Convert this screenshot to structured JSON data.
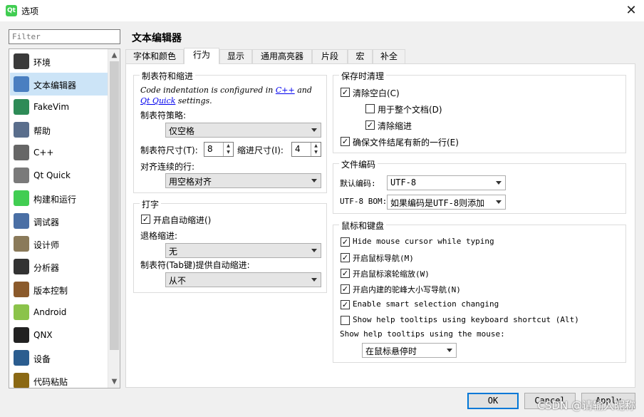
{
  "window": {
    "title": "选项",
    "app_icon": "Qt",
    "close": "✕"
  },
  "filter": {
    "placeholder": "Filter"
  },
  "sidebar": {
    "items": [
      {
        "label": "环境",
        "icon": "monitor-icon",
        "color": "#3a3a3a"
      },
      {
        "label": "文本编辑器",
        "icon": "text-editor-icon",
        "color": "#4a7fc1"
      },
      {
        "label": "FakeVim",
        "icon": "fakevim-icon",
        "color": "#2e8b57"
      },
      {
        "label": "帮助",
        "icon": "help-icon",
        "color": "#5a6e8c"
      },
      {
        "label": "C++",
        "icon": "braces-icon",
        "color": "#666666"
      },
      {
        "label": "Qt Quick",
        "icon": "qtquick-icon",
        "color": "#7a7a7a"
      },
      {
        "label": "构建和运行",
        "icon": "build-run-icon",
        "color": "#41cd52"
      },
      {
        "label": "调试器",
        "icon": "debugger-icon",
        "color": "#4a6fa5"
      },
      {
        "label": "设计师",
        "icon": "designer-icon",
        "color": "#8a7a5a"
      },
      {
        "label": "分析器",
        "icon": "analyzer-icon",
        "color": "#333333"
      },
      {
        "label": "版本控制",
        "icon": "version-control-icon",
        "color": "#8b5a2b"
      },
      {
        "label": "Android",
        "icon": "android-icon",
        "color": "#8bc34a"
      },
      {
        "label": "QNX",
        "icon": "qnx-icon",
        "color": "#222222"
      },
      {
        "label": "设备",
        "icon": "device-icon",
        "color": "#2b5d8f"
      },
      {
        "label": "代码粘贴",
        "icon": "paste-icon",
        "color": "#8b6914"
      }
    ]
  },
  "page_title": "文本编辑器",
  "tabs": [
    "字体和颜色",
    "行为",
    "显示",
    "通用高亮器",
    "片段",
    "宏",
    "补全"
  ],
  "tabs_and_indent": {
    "title": "制表符和缩进",
    "info_prefix": "Code indentation is configured in ",
    "info_link1": "C++",
    "info_mid": " and",
    "info_link2": "Qt Quick",
    "info_suffix": " settings.",
    "tab_policy_label": "制表符策略:",
    "tab_policy_value": "仅空格",
    "tab_size_label": "制表符尺寸(T):",
    "tab_size_value": "8",
    "indent_size_label": "缩进尺寸(I):",
    "indent_size_value": "4",
    "align_label": "对齐连续的行:",
    "align_value": "用空格对齐"
  },
  "typing": {
    "title": "打字",
    "auto_indent_label": "开启自动缩进()",
    "auto_indent_checked": true,
    "backspace_label": "退格缩进:",
    "backspace_value": "无",
    "tab_key_label": "制表符(Tab键)提供自动缩进:",
    "tab_key_value": "从不"
  },
  "cleanup": {
    "title": "保存时清理",
    "clean_ws_label": "清除空白(C)",
    "clean_ws_checked": true,
    "whole_doc_label": "用于整个文档(D)",
    "whole_doc_checked": false,
    "clean_indent_label": "清除缩进",
    "clean_indent_checked": true,
    "newline_label": "确保文件结尾有新的一行(E)",
    "newline_checked": true
  },
  "encoding": {
    "title": "文件编码",
    "default_label": "默认编码:",
    "default_value": "UTF-8",
    "bom_label": "UTF-8 BOM:",
    "bom_value": "如果编码是UTF-8则添加"
  },
  "mouse_keyboard": {
    "title": "鼠标和键盘",
    "options": [
      {
        "label": "Hide mouse cursor while typing",
        "checked": true
      },
      {
        "label": "开启鼠标导航(M)",
        "checked": true
      },
      {
        "label": "开启鼠标滚轮缩放(W)",
        "checked": true
      },
      {
        "label": "开启内建的驼峰大小写导航(N)",
        "checked": true
      },
      {
        "label": "Enable smart selection changing",
        "checked": true
      },
      {
        "label": "Show help tooltips using keyboard shortcut (Alt)",
        "checked": false
      }
    ],
    "tooltip_mouse_label": "Show help tooltips using the mouse:",
    "tooltip_mouse_value": "在鼠标悬停时"
  },
  "buttons": {
    "ok": "OK",
    "cancel": "Cancel",
    "apply": "Apply"
  },
  "watermark": "CSDN @请输入昵称"
}
